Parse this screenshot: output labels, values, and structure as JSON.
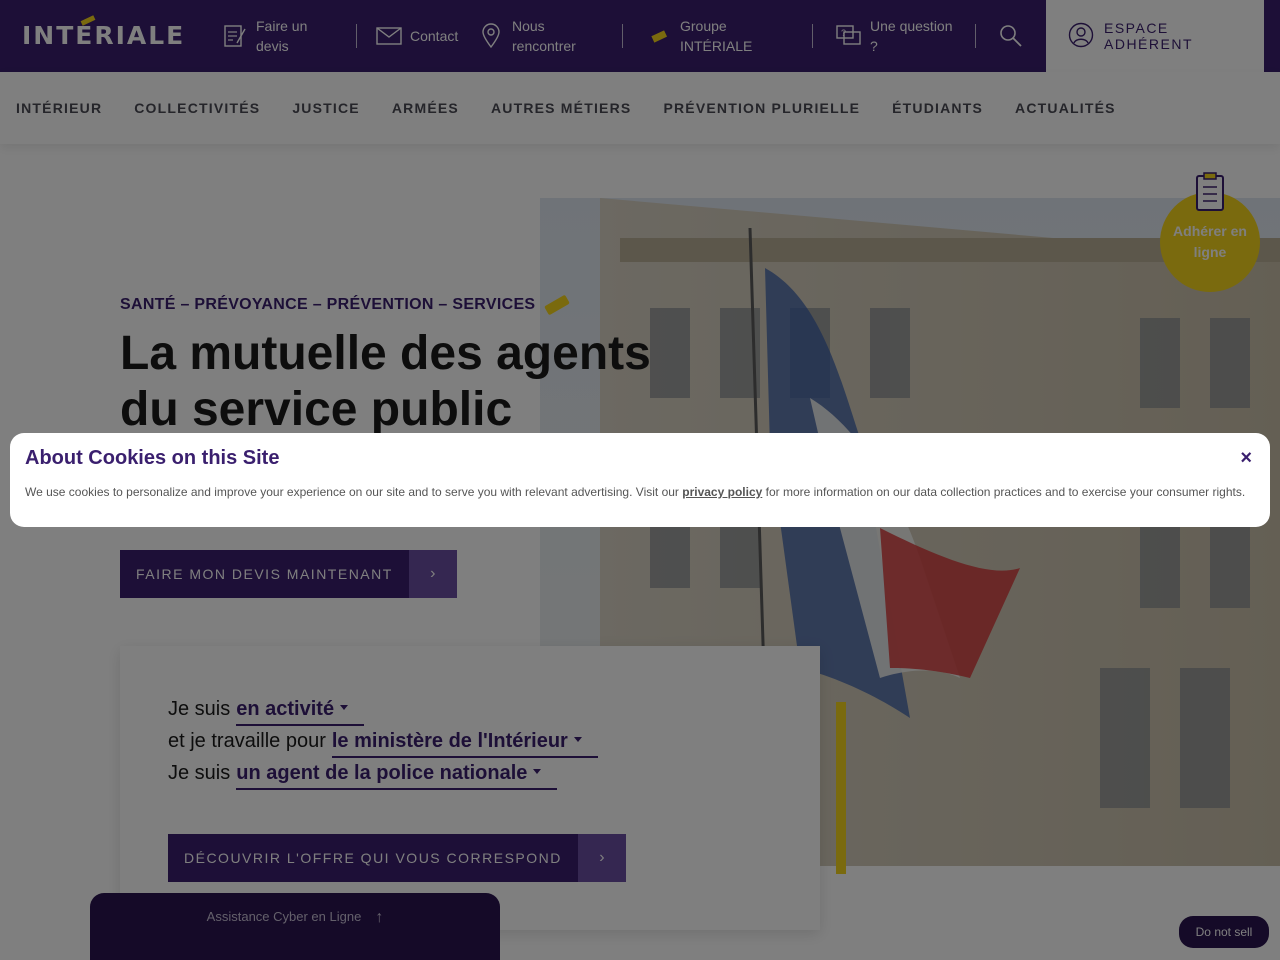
{
  "topbar": {
    "logo_text": "INTÉRIALE",
    "devis": "Faire un devis",
    "contact": "Contact",
    "rencontrer": "Nous rencontrer",
    "groupe": "Groupe INTÉRIALE",
    "question": "Une question ?",
    "espace": "ESPACE ADHÉRENT"
  },
  "nav": [
    "INTÉRIEUR",
    "COLLECTIVITÉS",
    "JUSTICE",
    "ARMÉES",
    "AUTRES MÉTIERS",
    "PRÉVENTION PLURIELLE",
    "ÉTUDIANTS",
    "ACTUALITÉS"
  ],
  "hero": {
    "kicker": "SANTÉ – PRÉVOYANCE – PRÉVENTION – SERVICES",
    "title_line1": "La mutuelle des agents",
    "title_line2": "du service public",
    "cta": "FAIRE MON DEVIS MAINTENANT",
    "adherer": "Adhérer en ligne"
  },
  "form": {
    "line1_pre": "Je suis",
    "line1_value": "en activité",
    "line2_pre": "et je travaille pour",
    "line2_value": "le ministère de l'Intérieur",
    "line3_pre": "Je suis",
    "line3_value": "un agent de la police nationale",
    "cta": "DÉCOUVRIR L'OFFRE QUI VOUS CORRESPOND"
  },
  "cookie": {
    "title": "About Cookies on this Site",
    "text_before": "We use cookies to personalize and improve your experience on our site and to serve you with relevant advertising. Visit our ",
    "link": "privacy policy",
    "text_after": " for more information on our data collection practices and to exercise your consumer rights.",
    "close": "×"
  },
  "assist": {
    "label": "Assistance Cyber en Ligne"
  },
  "dns": {
    "label": "Do not sell"
  },
  "colors": {
    "brand": "#3a1f6e",
    "accent": "#f5d51c"
  }
}
